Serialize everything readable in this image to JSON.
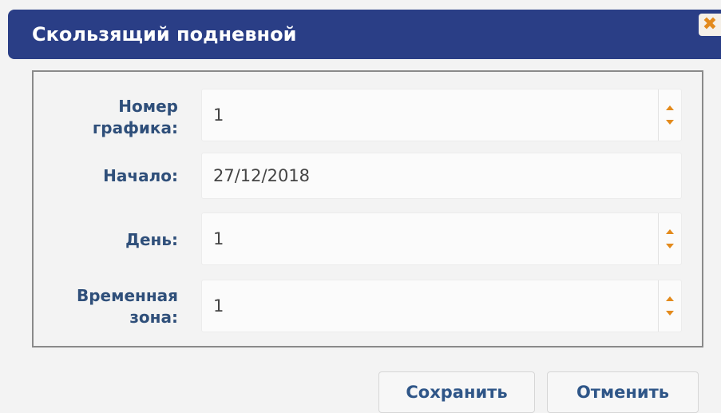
{
  "dialog": {
    "title": "Скользящий подневной",
    "close_icon": "close-icon"
  },
  "form": {
    "schedule_number": {
      "label_line1": "Номер",
      "label_line2": "графика:",
      "value": "1"
    },
    "start": {
      "label": "Начало:",
      "value": "27/12/2018"
    },
    "day": {
      "label": "День:",
      "value": "1"
    },
    "time_zone": {
      "label_line1": "Временная",
      "label_line2": "зона:",
      "value": "1"
    }
  },
  "buttons": {
    "save_label": "Сохранить",
    "cancel_label": "Отменить"
  },
  "colors": {
    "title_bar": "#2a3e86",
    "accent": "#e38a1c",
    "label_text": "#2f4f7a"
  }
}
